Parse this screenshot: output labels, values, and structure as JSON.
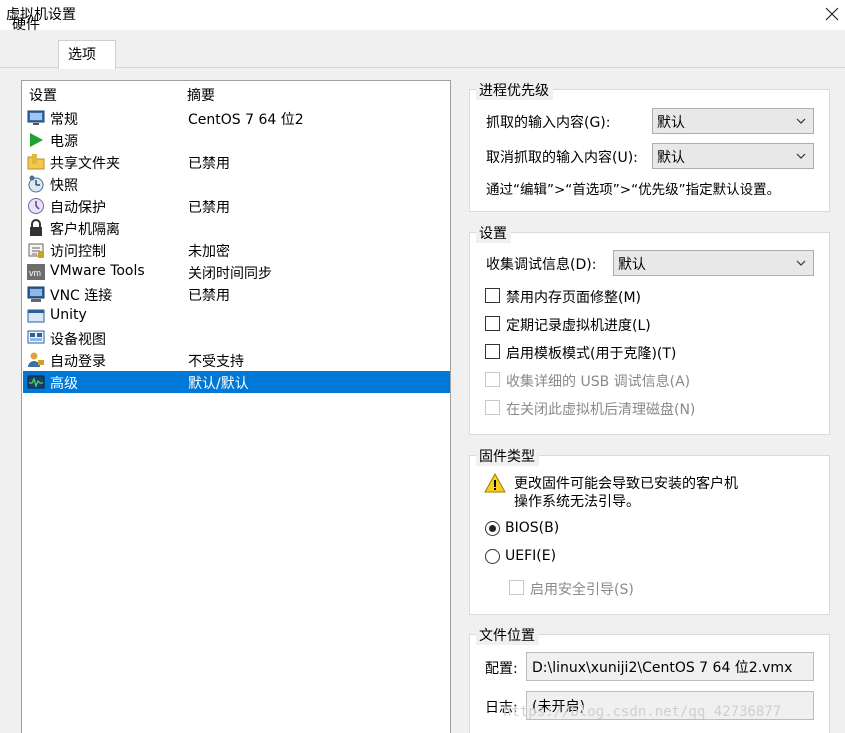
{
  "window": {
    "title": "虚拟机设置"
  },
  "tabs": [
    {
      "label": "硬件"
    },
    {
      "label": "选项"
    }
  ],
  "list": {
    "headers": {
      "setting": "设置",
      "summary": "摘要"
    },
    "rows": [
      {
        "label": "常规",
        "summary": "CentOS 7 64 位2",
        "icon": "monitor-icon"
      },
      {
        "label": "电源",
        "summary": "",
        "icon": "play-icon"
      },
      {
        "label": "共享文件夹",
        "summary": "已禁用",
        "icon": "shared-folder-icon"
      },
      {
        "label": "快照",
        "summary": "",
        "icon": "snapshot-icon"
      },
      {
        "label": "自动保护",
        "summary": "已禁用",
        "icon": "autoprotect-icon"
      },
      {
        "label": "客户机隔离",
        "summary": "",
        "icon": "lock-icon"
      },
      {
        "label": "访问控制",
        "summary": "未加密",
        "icon": "access-control-icon"
      },
      {
        "label": "VMware Tools",
        "summary": "关闭时间同步",
        "icon": "vmware-tools-icon"
      },
      {
        "label": "VNC 连接",
        "summary": "已禁用",
        "icon": "vnc-icon"
      },
      {
        "label": "Unity",
        "summary": "",
        "icon": "unity-icon"
      },
      {
        "label": "设备视图",
        "summary": "",
        "icon": "device-view-icon"
      },
      {
        "label": "自动登录",
        "summary": "不受支持",
        "icon": "auto-login-icon"
      },
      {
        "label": "高级",
        "summary": "默认/默认",
        "icon": "advanced-icon",
        "selected": true
      }
    ]
  },
  "priority": {
    "title": "进程优先级",
    "grab_label": "抓取的输入内容(G):",
    "grab_value": "默认",
    "ungrab_label": "取消抓取的输入内容(U):",
    "ungrab_value": "默认",
    "hint": "通过“编辑”>“首选项”>“优先级”指定默认设置。"
  },
  "settings": {
    "title": "设置",
    "debug_label": "收集调试信息(D):",
    "debug_value": "默认",
    "checkboxes": [
      {
        "label": "禁用内存页面修整(M)",
        "checked": false,
        "enabled": true
      },
      {
        "label": "定期记录虚拟机进度(L)",
        "checked": false,
        "enabled": true
      },
      {
        "label": "启用模板模式(用于克隆)(T)",
        "checked": false,
        "enabled": true
      },
      {
        "label": "收集详细的 USB 调试信息(A)",
        "checked": false,
        "enabled": false
      },
      {
        "label": "在关闭此虚拟机后清理磁盘(N)",
        "checked": false,
        "enabled": false
      }
    ]
  },
  "firmware": {
    "title": "固件类型",
    "warning_line1": "更改固件可能会导致已安装的客户机",
    "warning_line2": "操作系统无法引导。",
    "bios_label": "BIOS(B)",
    "uefi_label": "UEFI(E)",
    "selected": "BIOS",
    "secure_boot_label": "启用安全引导(S)"
  },
  "file_location": {
    "title": "文件位置",
    "config_label": "配置:",
    "config_value": "D:\\linux\\xuniji2\\CentOS 7 64 位2.vmx",
    "log_label": "日志:",
    "log_value": "(未开启)"
  },
  "watermark": "https://blog.csdn.net/qq_42736877",
  "colors": {
    "selection": "#0078d7",
    "panel_bg": "#f0f0f0"
  }
}
